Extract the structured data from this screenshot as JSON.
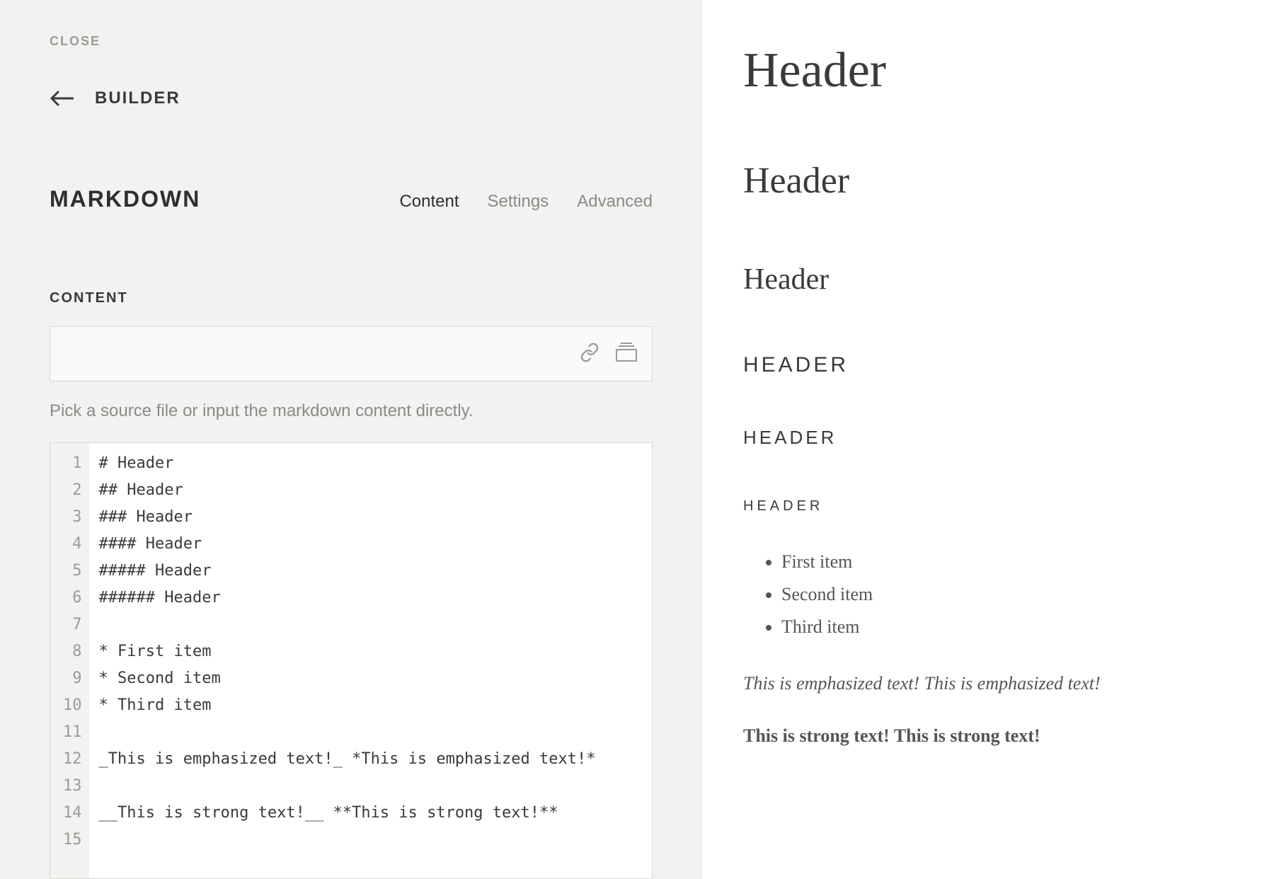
{
  "left": {
    "close": "CLOSE",
    "builder": "BUILDER",
    "title": "MARKDOWN",
    "tabs": {
      "content": "Content",
      "settings": "Settings",
      "advanced": "Advanced"
    },
    "sectionLabel": "CONTENT",
    "hint": "Pick a source file or input the markdown content directly.",
    "lines": [
      "# Header",
      "## Header",
      "### Header",
      "#### Header",
      "##### Header",
      "###### Header",
      "",
      "* First item",
      "* Second item",
      "* Third item",
      "",
      "_This is emphasized text!_ *This is emphasized text!*",
      "",
      "__This is strong text!__ **This is strong text!**",
      ""
    ]
  },
  "preview": {
    "h1": "Header",
    "h2": "Header",
    "h3": "Header",
    "h4": "HEADER",
    "h5": "HEADER",
    "h6": "HEADER",
    "items": [
      "First item",
      "Second item",
      "Third item"
    ],
    "emphasized": "This is emphasized text! This is emphasized text!",
    "strong": "This is strong text! This is strong text!"
  }
}
